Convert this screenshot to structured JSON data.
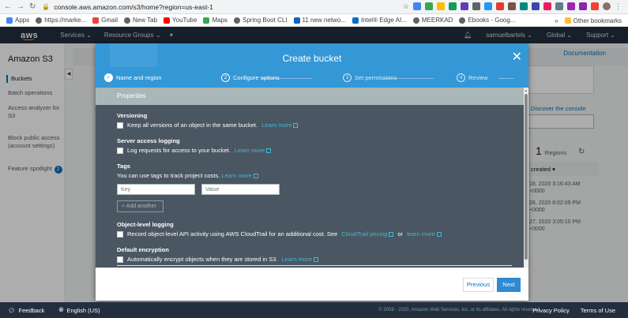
{
  "browser": {
    "url": "console.aws.amazon.com/s3/home?region=us-east-1",
    "bookmarks": [
      {
        "label": "Apps",
        "color": "#4285f4"
      },
      {
        "label": "https://marke...",
        "color": "#5f6368"
      },
      {
        "label": "Gmail",
        "color": "#ea4335"
      },
      {
        "label": "New Tab",
        "color": "#5f6368"
      },
      {
        "label": "YouTube",
        "color": "#ff0000"
      },
      {
        "label": "Maps",
        "color": "#34a853"
      },
      {
        "label": "Spring Boot CLI",
        "color": "#5f6368"
      },
      {
        "label": "11 new netwo...",
        "color": "#0a66c2"
      },
      {
        "label": "Intel® Edge AI...",
        "color": "#0071c5"
      },
      {
        "label": "MEERKAD",
        "color": "#5f6368"
      },
      {
        "label": "Ebooks - Goog...",
        "color": "#5f6368"
      }
    ],
    "more_bookmarks": "»",
    "other_bookmarks": "Other bookmarks"
  },
  "aws": {
    "logo": "aws",
    "services": "Services",
    "resource_groups": "Resource Groups",
    "user": "samuelbartels",
    "region": "Global",
    "support": "Support"
  },
  "sidebar": {
    "title": "Amazon S3",
    "items": [
      "Buckets",
      "Batch operations",
      "Access analyzer for S3",
      "Block public access (account settings)",
      "Feature spotlight"
    ],
    "badge": "2"
  },
  "background": {
    "documentation": "Documentation",
    "discover": "Discover the console",
    "regions_count": "1",
    "regions_label": "Regions",
    "created_header": "created ▾",
    "rows": [
      [
        "18, 2020 3:16:43 AM",
        "+0000"
      ],
      [
        "28, 2020 8:02:09 PM",
        "+0000"
      ],
      [
        "27, 2020 3:05:10 PM",
        "+0000"
      ]
    ]
  },
  "modal": {
    "title": "Create bucket",
    "steps": [
      {
        "num": "✓",
        "label": "Name and region"
      },
      {
        "num": "2",
        "label": "Configure options"
      },
      {
        "num": "3",
        "label": "Set permissions"
      },
      {
        "num": "4",
        "label": "Review"
      }
    ],
    "properties_header": "Properties",
    "versioning": {
      "title": "Versioning",
      "option": "Keep all versions of an object in the same bucket.",
      "link": "Learn more"
    },
    "access_logging": {
      "title": "Server access logging",
      "option": "Log requests for access to your bucket.",
      "link": "Learn more"
    },
    "tags": {
      "title": "Tags",
      "desc": "You can use tags to track project costs.",
      "link": "Learn more",
      "key_placeholder": "Key",
      "value_placeholder": "Value",
      "add_label": "+ Add another"
    },
    "object_logging": {
      "title": "Object-level logging",
      "option": "Record object-level API activity using AWS CloudTrail for an additional cost. See",
      "link1": "CloudTrail pricing",
      "or": "or",
      "link2": "learn more"
    },
    "encryption": {
      "title": "Default encryption",
      "option": "Automatically encrypt objects when they are stored in S3.",
      "link": "Learn more"
    },
    "previous": "Previous",
    "next": "Next"
  },
  "footer": {
    "feedback": "Feedback",
    "language": "English (US)",
    "copyright": "© 2008 - 2020, Amazon Web Services, Inc. or its affiliates. All rights reserved.",
    "privacy": "Privacy Policy",
    "terms": "Terms of Use"
  }
}
